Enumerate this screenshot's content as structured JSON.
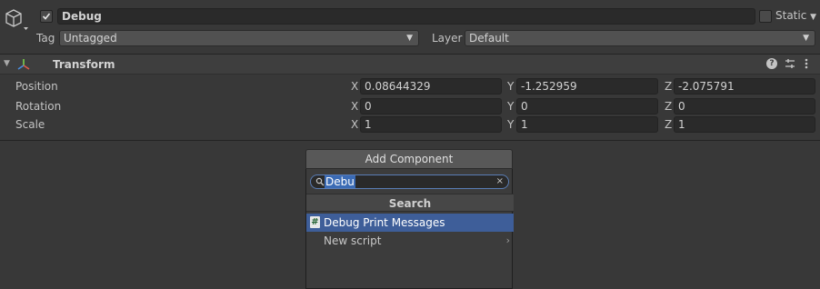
{
  "header": {
    "object_name": "Debug",
    "active_checked": true,
    "static_label": "Static",
    "static_checked": false,
    "tag_label": "Tag",
    "tag_value": "Untagged",
    "layer_label": "Layer",
    "layer_value": "Default"
  },
  "transform": {
    "title": "Transform",
    "rows": [
      {
        "label": "Position",
        "x": "0.08644329",
        "y": "-1.252959",
        "z": "-2.075791"
      },
      {
        "label": "Rotation",
        "x": "0",
        "y": "0",
        "z": "0"
      },
      {
        "label": "Scale",
        "x": "1",
        "y": "1",
        "z": "1"
      }
    ],
    "axis_labels": {
      "x": "X",
      "y": "Y",
      "z": "Z"
    }
  },
  "add_component": {
    "button_label": "Add Component",
    "search_value": "Debu",
    "section_title": "Search",
    "items": [
      {
        "label": "Debug Print Messages",
        "icon": "script-hash-icon",
        "selected": true
      },
      {
        "label": "New script",
        "icon": "chevron-right-icon",
        "selected": false
      }
    ]
  },
  "colors": {
    "background": "#383838",
    "field": "#2a2a2a",
    "selection": "#3e5e99",
    "text_selection": "#3b6bb5"
  }
}
